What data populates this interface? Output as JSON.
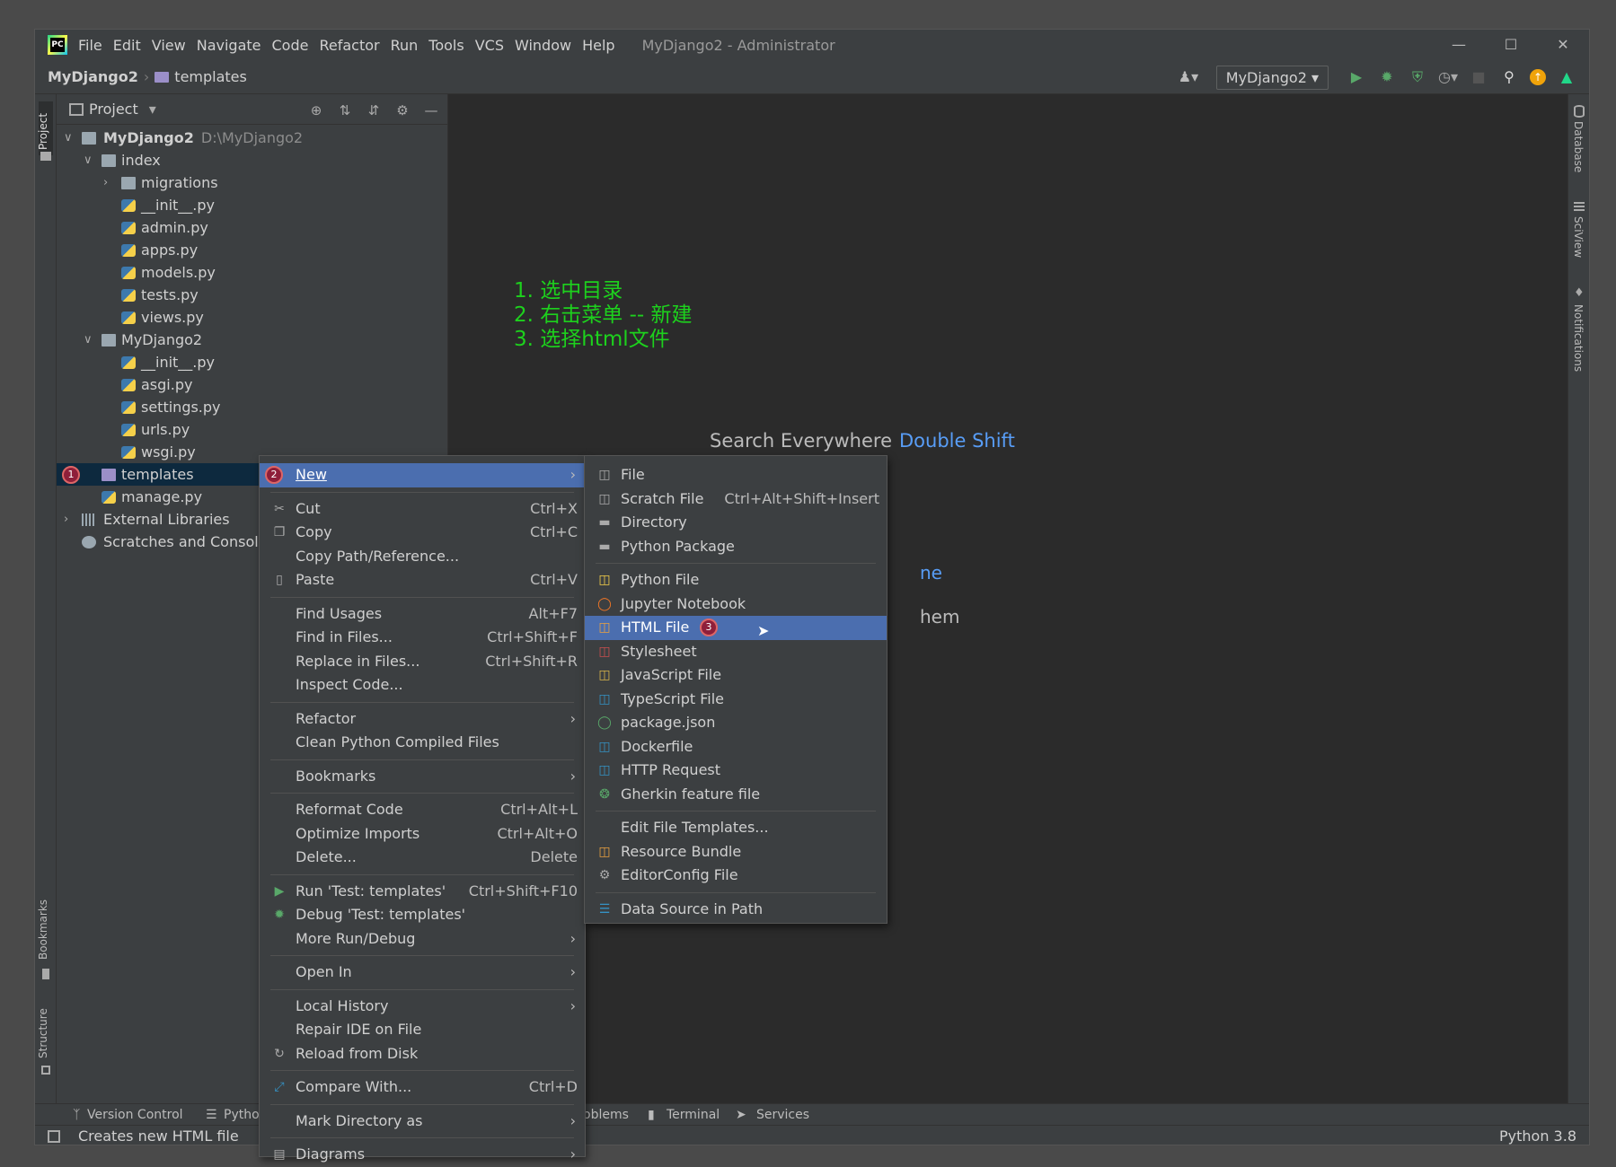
{
  "app": {
    "menu": [
      "File",
      "Edit",
      "View",
      "Navigate",
      "Code",
      "Refactor",
      "Run",
      "Tools",
      "VCS",
      "Window",
      "Help"
    ],
    "window_title": "MyDjango2 - Administrator"
  },
  "navbar": {
    "crumb_project": "MyDjango2",
    "crumb_folder": "templates",
    "run_config": "MyDjango2"
  },
  "project_panel": {
    "title": "Project",
    "tree": [
      {
        "label": "MyDjango2",
        "path": "D:\\MyDjango2"
      },
      {
        "label": "index"
      },
      {
        "label": "migrations"
      },
      {
        "label": "__init__.py"
      },
      {
        "label": "admin.py"
      },
      {
        "label": "apps.py"
      },
      {
        "label": "models.py"
      },
      {
        "label": "tests.py"
      },
      {
        "label": "views.py"
      },
      {
        "label": "MyDjango2"
      },
      {
        "label": "__init__.py"
      },
      {
        "label": "asgi.py"
      },
      {
        "label": "settings.py"
      },
      {
        "label": "urls.py"
      },
      {
        "label": "wsgi.py"
      },
      {
        "label": "templates",
        "badge": "1"
      },
      {
        "label": "manage.py"
      },
      {
        "label": "External Libraries"
      },
      {
        "label": "Scratches and Consoles"
      }
    ]
  },
  "editor": {
    "steps": [
      "1. 选中目录",
      "2. 右击菜单 -- 新建",
      "3. 选择html文件"
    ],
    "hint_text": "Search Everywhere",
    "hint_key": "Double Shift",
    "partial_1": "ne",
    "partial_2": "hem"
  },
  "context_menu": {
    "new_badge": "2",
    "items": [
      {
        "label": "New",
        "shortcut": ""
      },
      {
        "label": "Cut",
        "shortcut": "Ctrl+X"
      },
      {
        "label": "Copy",
        "shortcut": "Ctrl+C"
      },
      {
        "label": "Copy Path/Reference...",
        "shortcut": ""
      },
      {
        "label": "Paste",
        "shortcut": "Ctrl+V"
      },
      {
        "label": "Find Usages",
        "shortcut": "Alt+F7"
      },
      {
        "label": "Find in Files...",
        "shortcut": "Ctrl+Shift+F"
      },
      {
        "label": "Replace in Files...",
        "shortcut": "Ctrl+Shift+R"
      },
      {
        "label": "Inspect Code...",
        "shortcut": ""
      },
      {
        "label": "Refactor",
        "shortcut": ""
      },
      {
        "label": "Clean Python Compiled Files",
        "shortcut": ""
      },
      {
        "label": "Bookmarks",
        "shortcut": ""
      },
      {
        "label": "Reformat Code",
        "shortcut": "Ctrl+Alt+L"
      },
      {
        "label": "Optimize Imports",
        "shortcut": "Ctrl+Alt+O"
      },
      {
        "label": "Delete...",
        "shortcut": "Delete"
      },
      {
        "label": "Run 'Test: templates'",
        "shortcut": "Ctrl+Shift+F10"
      },
      {
        "label": "Debug 'Test: templates'",
        "shortcut": ""
      },
      {
        "label": "More Run/Debug",
        "shortcut": ""
      },
      {
        "label": "Open In",
        "shortcut": ""
      },
      {
        "label": "Local History",
        "shortcut": ""
      },
      {
        "label": "Repair IDE on File",
        "shortcut": ""
      },
      {
        "label": "Reload from Disk",
        "shortcut": ""
      },
      {
        "label": "Compare With...",
        "shortcut": "Ctrl+D"
      },
      {
        "label": "Mark Directory as",
        "shortcut": ""
      },
      {
        "label": "Diagrams",
        "shortcut": ""
      }
    ]
  },
  "new_submenu": {
    "html_badge": "3",
    "items": [
      {
        "label": "File",
        "shortcut": ""
      },
      {
        "label": "Scratch File",
        "shortcut": "Ctrl+Alt+Shift+Insert"
      },
      {
        "label": "Directory",
        "shortcut": ""
      },
      {
        "label": "Python Package",
        "shortcut": ""
      },
      {
        "label": "Python File",
        "shortcut": ""
      },
      {
        "label": "Jupyter Notebook",
        "shortcut": ""
      },
      {
        "label": "HTML File",
        "shortcut": ""
      },
      {
        "label": "Stylesheet",
        "shortcut": ""
      },
      {
        "label": "JavaScript File",
        "shortcut": ""
      },
      {
        "label": "TypeScript File",
        "shortcut": ""
      },
      {
        "label": "package.json",
        "shortcut": ""
      },
      {
        "label": "Dockerfile",
        "shortcut": ""
      },
      {
        "label": "HTTP Request",
        "shortcut": ""
      },
      {
        "label": "Gherkin feature file",
        "shortcut": ""
      },
      {
        "label": "Edit File Templates...",
        "shortcut": ""
      },
      {
        "label": "Resource Bundle",
        "shortcut": ""
      },
      {
        "label": "EditorConfig File",
        "shortcut": ""
      },
      {
        "label": "Data Source in Path",
        "shortcut": ""
      }
    ]
  },
  "side_tabs": {
    "left_top": "Project",
    "left_bookmarks": "Bookmarks",
    "left_structure": "Structure",
    "right_database": "Database",
    "right_sciview": "SciView",
    "right_notifications": "Notifications"
  },
  "bottom_tabs": {
    "version_control": "Version Control",
    "python": "Pythor",
    "problems": "oblems",
    "terminal": "Terminal",
    "services": "Services"
  },
  "status": {
    "message": "Creates new HTML file",
    "interpreter": "Python 3.8"
  }
}
